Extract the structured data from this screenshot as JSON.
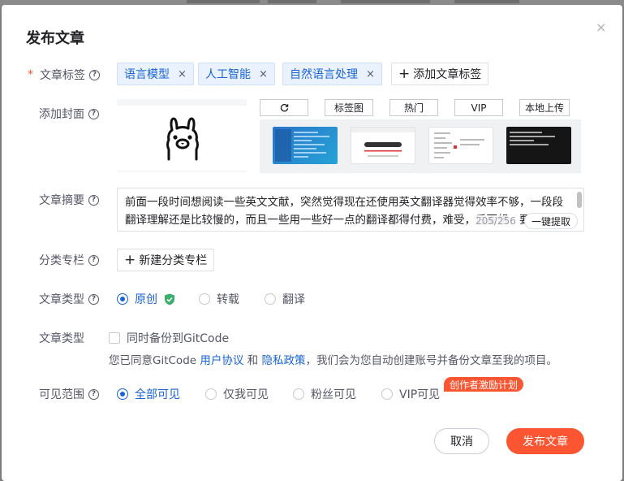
{
  "dialog": {
    "title": "发布文章",
    "close_glyph": "×"
  },
  "tags": {
    "label": "文章标签",
    "required_mark": "*",
    "items": [
      {
        "label": "语言模型"
      },
      {
        "label": "人工智能"
      },
      {
        "label": "自然语言处理"
      }
    ],
    "remove_glyph": "×",
    "add_label": "添加文章标签"
  },
  "cover": {
    "label": "添加封面",
    "tabs": [
      "",
      "标签图",
      "热门",
      "VIP",
      "本地上传"
    ],
    "refresh_icon": "refresh-icon",
    "cover_image": "llama-logo"
  },
  "summary": {
    "label": "文章摘要",
    "text": "前面一段时间想阅读一些英文文献，突然觉得现在还使用英文翻译器觉得效率不够，一段段翻译理解还是比较慢的，而且一些用一些好一点的翻译都得付费，难受，后面想，要用在AI大模型这么火，而且越来越能让普通人用起来，我为何不自己操作一个，要么不想",
    "counter": "205/256",
    "extract_label": "一键提取"
  },
  "column": {
    "label": "分类专栏",
    "add_label": "新建分类专栏"
  },
  "article_type": {
    "label": "文章类型",
    "options": [
      {
        "label": "原创",
        "selected": true
      },
      {
        "label": "转载",
        "selected": false
      },
      {
        "label": "翻译",
        "selected": false
      }
    ]
  },
  "backup": {
    "label": "文章类型",
    "checkbox_label": "同时备份到GitCode",
    "checked": false,
    "agree_prefix": "您已同意GitCode ",
    "agree_link1": "用户协议",
    "agree_and": " 和 ",
    "agree_link2": "隐私政策",
    "agree_suffix": "，我们会为您自动创建账号并备份文章至我的项目。"
  },
  "visibility": {
    "label": "可见范围",
    "options": [
      {
        "label": "全部可见",
        "selected": true
      },
      {
        "label": "仅我可见",
        "selected": false
      },
      {
        "label": "粉丝可见",
        "selected": false
      },
      {
        "label": "VIP可见",
        "selected": false
      }
    ],
    "badge": "创作者激励计划"
  },
  "footer": {
    "cancel_label": "取消",
    "publish_label": "发布文章"
  },
  "colors": {
    "accent": "#fc5531",
    "link": "#1a63d4",
    "tag_bg": "#eaf2ff"
  }
}
